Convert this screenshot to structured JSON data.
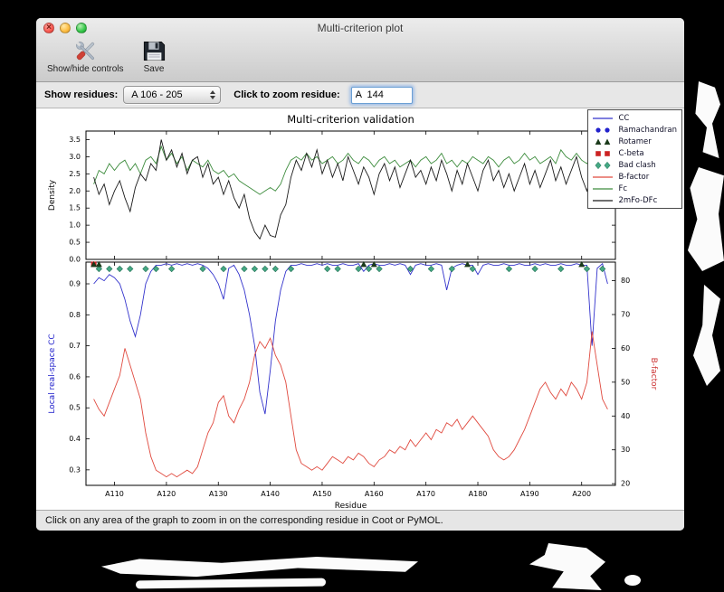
{
  "window": {
    "title": "Multi-criterion plot"
  },
  "toolbar": {
    "items": [
      {
        "label": "Show/hide controls",
        "icon": "crossed-tools-icon"
      },
      {
        "label": "Save",
        "icon": "floppy-disk-icon"
      }
    ]
  },
  "controls": {
    "show_residues_label": "Show residues:",
    "residue_range_value": "A 106 - 205",
    "zoom_label": "Click to zoom residue:",
    "zoom_value": "A  144"
  },
  "status_bar": {
    "text": "Click on any area of the graph to zoom in on the corresponding residue in Coot or PyMOL."
  },
  "chart_data": {
    "type": "line",
    "title": "Multi-criterion validation",
    "xlabel": "Residue",
    "x_start": 106,
    "x_end": 205,
    "xlim": [
      104.5,
      206.5
    ],
    "x_ticks": [
      {
        "label": "A110",
        "value": 110
      },
      {
        "label": "A120",
        "value": 120
      },
      {
        "label": "A130",
        "value": 130
      },
      {
        "label": "A140",
        "value": 140
      },
      {
        "label": "A150",
        "value": 150
      },
      {
        "label": "A160",
        "value": 160
      },
      {
        "label": "A170",
        "value": 170
      },
      {
        "label": "A180",
        "value": 180
      },
      {
        "label": "A190",
        "value": 190
      },
      {
        "label": "A200",
        "value": 200
      }
    ],
    "top_plot": {
      "ylabel": "Density",
      "ylim": [
        0,
        3.75
      ],
      "yticks": [
        0.0,
        0.5,
        1.0,
        1.5,
        2.0,
        2.5,
        3.0,
        3.5
      ],
      "series": [
        {
          "name": "Fc",
          "color": "#3d8c3d",
          "values": [
            2.2,
            2.6,
            2.5,
            2.8,
            2.6,
            2.8,
            2.9,
            2.6,
            2.8,
            2.5,
            2.9,
            3.0,
            2.8,
            3.3,
            2.9,
            3.1,
            2.8,
            3.0,
            2.6,
            2.9,
            2.8,
            2.7,
            2.9,
            2.6,
            2.5,
            2.6,
            2.4,
            2.5,
            2.3,
            2.2,
            2.1,
            2.0,
            1.9,
            2.0,
            2.1,
            2.0,
            2.2,
            2.6,
            2.9,
            3.0,
            2.9,
            3.1,
            2.9,
            3.0,
            2.8,
            2.9,
            3.0,
            2.8,
            2.9,
            3.1,
            2.9,
            2.8,
            3.0,
            2.9,
            2.7,
            2.9,
            3.0,
            2.8,
            2.9,
            2.7,
            2.8,
            2.9,
            2.7,
            2.9,
            3.0,
            2.8,
            2.9,
            3.1,
            2.8,
            2.9,
            2.7,
            2.9,
            2.8,
            3.0,
            2.9,
            2.8,
            3.0,
            2.9,
            2.7,
            2.9,
            3.0,
            2.8,
            2.9,
            3.1,
            2.9,
            3.0,
            2.8,
            2.9,
            3.0,
            2.8,
            3.2,
            3.0,
            2.9,
            3.1,
            2.9,
            2.8,
            3.0,
            2.7,
            2.9,
            2.8
          ]
        },
        {
          "name": "2mFo-DFc",
          "color": "#1a1a1a",
          "values": [
            2.4,
            1.9,
            2.2,
            1.6,
            2.0,
            2.3,
            1.8,
            1.4,
            2.1,
            2.5,
            2.3,
            2.8,
            2.6,
            3.5,
            2.9,
            3.2,
            2.7,
            3.1,
            2.5,
            2.9,
            3.0,
            2.4,
            2.8,
            2.2,
            2.4,
            1.9,
            2.3,
            1.8,
            1.5,
            1.9,
            1.2,
            0.8,
            0.6,
            1.0,
            0.7,
            0.65,
            1.3,
            1.6,
            2.4,
            2.9,
            2.6,
            3.1,
            2.7,
            3.2,
            2.5,
            2.9,
            2.4,
            2.8,
            2.3,
            3.0,
            2.6,
            2.2,
            2.7,
            2.4,
            1.9,
            2.5,
            2.8,
            2.3,
            2.7,
            2.1,
            2.5,
            2.9,
            2.4,
            2.6,
            2.2,
            2.7,
            2.3,
            2.9,
            2.5,
            2.0,
            2.6,
            2.2,
            2.8,
            2.4,
            2.0,
            2.6,
            2.9,
            2.3,
            2.6,
            2.1,
            2.5,
            2.0,
            2.4,
            2.8,
            2.2,
            2.6,
            2.1,
            2.5,
            2.9,
            2.3,
            2.7,
            2.2,
            2.6,
            3.0,
            2.4,
            2.0,
            2.6,
            1.8,
            2.3,
            2.6
          ]
        }
      ]
    },
    "bottom_plot": {
      "ylabel_left": "Local real-space CC",
      "ylabel_left_color": "#2222cc",
      "ylim_left": [
        0.25,
        0.97
      ],
      "yticks_left": [
        0.3,
        0.4,
        0.5,
        0.6,
        0.7,
        0.8,
        0.9
      ],
      "ylabel_right": "B-factor",
      "ylabel_right_color": "#cc3333",
      "ylim_right": [
        19.5,
        85.5
      ],
      "yticks_right": [
        20,
        30,
        40,
        50,
        60,
        70,
        80
      ],
      "cc_series": {
        "name": "CC",
        "color": "#3333cc",
        "values": [
          0.9,
          0.92,
          0.91,
          0.93,
          0.92,
          0.9,
          0.85,
          0.78,
          0.73,
          0.8,
          0.9,
          0.94,
          0.96,
          0.96,
          0.965,
          0.96,
          0.965,
          0.96,
          0.965,
          0.96,
          0.965,
          0.96,
          0.95,
          0.93,
          0.9,
          0.85,
          0.95,
          0.96,
          0.93,
          0.88,
          0.8,
          0.7,
          0.55,
          0.48,
          0.62,
          0.78,
          0.88,
          0.94,
          0.96,
          0.96,
          0.965,
          0.96,
          0.96,
          0.965,
          0.96,
          0.965,
          0.96,
          0.96,
          0.965,
          0.96,
          0.96,
          0.965,
          0.94,
          0.96,
          0.965,
          0.96,
          0.96,
          0.965,
          0.96,
          0.965,
          0.96,
          0.93,
          0.96,
          0.965,
          0.96,
          0.96,
          0.965,
          0.96,
          0.88,
          0.95,
          0.96,
          0.965,
          0.96,
          0.96,
          0.93,
          0.96,
          0.965,
          0.96,
          0.96,
          0.965,
          0.96,
          0.96,
          0.965,
          0.96,
          0.96,
          0.965,
          0.96,
          0.965,
          0.96,
          0.96,
          0.965,
          0.96,
          0.96,
          0.965,
          0.96,
          0.96,
          0.7,
          0.95,
          0.965,
          0.9
        ]
      },
      "bfactor_series": {
        "name": "B-factor",
        "color": "#e04a3f",
        "values": [
          45,
          42,
          40,
          44,
          48,
          52,
          60,
          55,
          50,
          45,
          35,
          28,
          24,
          23,
          22,
          23,
          22,
          23,
          24,
          23,
          25,
          30,
          35,
          38,
          44,
          46,
          40,
          38,
          42,
          45,
          50,
          58,
          62,
          60,
          63,
          58,
          55,
          50,
          40,
          30,
          26,
          25,
          24,
          25,
          24,
          26,
          28,
          27,
          26,
          28,
          27,
          29,
          28,
          26,
          25,
          27,
          28,
          30,
          29,
          31,
          30,
          33,
          31,
          33,
          35,
          33,
          36,
          35,
          38,
          37,
          39,
          36,
          38,
          40,
          38,
          36,
          34,
          30,
          28,
          27,
          28,
          30,
          33,
          36,
          40,
          44,
          48,
          50,
          47,
          45,
          48,
          46,
          50,
          48,
          45,
          50,
          65,
          55,
          45,
          42
        ]
      },
      "markers": {
        "ramachandran": {
          "color": "#2222cc",
          "shape": "circle",
          "residues": []
        },
        "rotamer": {
          "color": "#1a3a1a",
          "shape": "triangle",
          "residues": [
            106,
            107,
            158,
            160,
            178,
            200
          ]
        },
        "cbeta": {
          "color": "#cc2222",
          "shape": "square",
          "residues": [
            106
          ]
        },
        "bad_clash": {
          "color": "#45a884",
          "shape": "diamond",
          "residues": [
            107,
            109,
            111,
            113,
            116,
            118,
            121,
            127,
            131,
            135,
            137,
            139,
            141,
            144,
            151,
            153,
            157,
            159,
            161,
            167,
            171,
            175,
            179,
            186,
            191,
            196,
            201,
            204
          ]
        }
      }
    },
    "legend": {
      "position": "upper right",
      "items": [
        {
          "label": "CC",
          "type": "line",
          "color": "#3333cc"
        },
        {
          "label": "Ramachandran",
          "type": "circles",
          "color": "#2222cc"
        },
        {
          "label": "Rotamer",
          "type": "triangles",
          "color": "#1a3a1a"
        },
        {
          "label": "C-beta",
          "type": "squares",
          "color": "#cc2222"
        },
        {
          "label": "Bad clash",
          "type": "diamonds",
          "color": "#45a884"
        },
        {
          "label": "B-factor",
          "type": "line",
          "color": "#e04a3f"
        },
        {
          "label": "Fc",
          "type": "line",
          "color": "#3d8c3d"
        },
        {
          "label": "2mFo-DFc",
          "type": "line",
          "color": "#1a1a1a"
        }
      ]
    }
  }
}
